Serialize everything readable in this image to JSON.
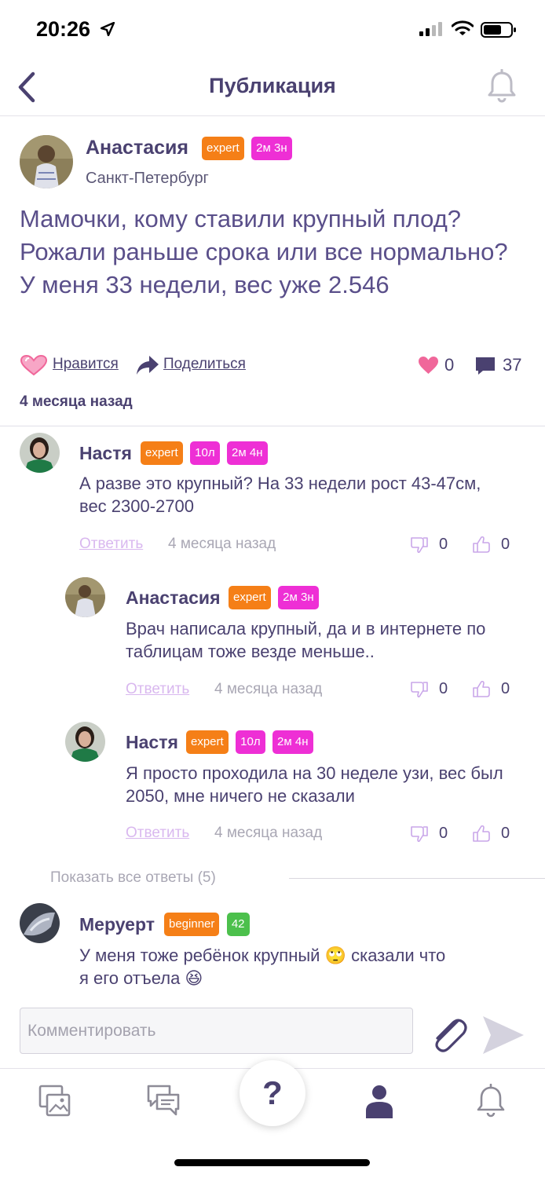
{
  "status_bar": {
    "time": "20:26"
  },
  "header": {
    "title": "Публикация"
  },
  "post": {
    "author": "Анастасия",
    "badges": [
      {
        "text": "expert",
        "color": "#f57f17"
      },
      {
        "text": "2м 3н",
        "color": "#ee2fd5"
      }
    ],
    "city": "Санкт-Петербург",
    "text": "Мамочки, кому ставили крупный плод? Рожали раньше срока или все нормально? У меня 33 недели, вес уже 2.546",
    "like_label": "Нравится",
    "share_label": "Поделиться",
    "likes_count": "0",
    "comments_count": "37",
    "time": "4 месяца назад"
  },
  "comments": [
    {
      "author": "Настя",
      "badges": [
        "expert",
        "10л",
        "2м 4н"
      ],
      "text": "А разве это крупный? На 33 недели рост 43-47см, вес 2300-2700",
      "reply_label": "Ответить",
      "time": "4 месяца назад",
      "dislikes": "0",
      "likes": "0"
    },
    {
      "author": "Анастасия",
      "badges": [
        "expert",
        "2м 3н"
      ],
      "text": "Врач написала крупный, да и в интернете по таблицам тоже везде меньше..",
      "reply_label": "Ответить",
      "time": "4 месяца назад",
      "dislikes": "0",
      "likes": "0"
    },
    {
      "author": "Настя",
      "badges": [
        "expert",
        "10л",
        "2м 4н"
      ],
      "text": "Я просто проходила на 30 неделе узи, вес был 2050, мне ничего не сказали",
      "reply_label": "Ответить",
      "time": "4 месяца назад",
      "dislikes": "0",
      "likes": "0"
    },
    {
      "author": "Меруерт",
      "badges": [
        "beginner",
        "42"
      ],
      "text_line1": "У меня тоже ребёнок крупный 🙄 сказали что",
      "text_line2": "я его отъела 😆"
    }
  ],
  "show_all_replies": "Показать все ответы (5)",
  "composer": {
    "placeholder": "Комментировать"
  },
  "tabbar": {
    "items": [
      "gallery-icon",
      "chat-icon",
      "question-icon",
      "profile-icon",
      "bell-icon"
    ],
    "help_symbol": "?"
  },
  "colors": {
    "primary": "#4a4170",
    "badge_orange": "#f57f17",
    "badge_pink": "#ee2fd5",
    "badge_green": "#4cc04c",
    "heart": "#f0679a",
    "reply": "#d9b8ef"
  }
}
